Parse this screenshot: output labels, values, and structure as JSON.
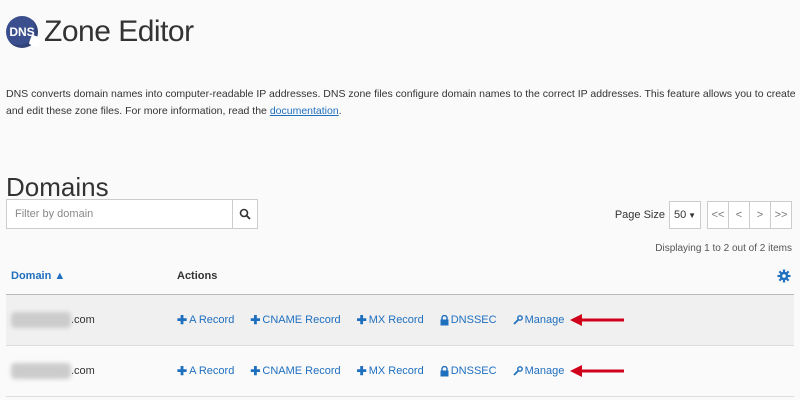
{
  "header": {
    "logo_text": "DNS",
    "title": "Zone Editor"
  },
  "description": {
    "text": "DNS converts domain names into computer-readable IP addresses. DNS zone files configure domain names to the correct IP addresses. This feature allows you to create and edit these zone files. For more information, read the ",
    "link": "documentation",
    "end": "."
  },
  "section_title": "Domains",
  "search": {
    "placeholder": "Filter by domain",
    "value": ""
  },
  "pager": {
    "label": "Page Size",
    "size": "50",
    "first": "<<",
    "prev": "<",
    "next": ">",
    "last": ">>"
  },
  "display_count": "Displaying 1 to 2 out of 2 items",
  "table": {
    "col_domain": "Domain ▲",
    "col_actions": "Actions",
    "rows": [
      {
        "domain_suffix": ".com",
        "actions": {
          "a": "A Record",
          "cname": "CNAME Record",
          "mx": "MX Record",
          "dnssec": "DNSSEC",
          "manage": "Manage"
        }
      },
      {
        "domain_suffix": ".com",
        "actions": {
          "a": "A Record",
          "cname": "CNAME Record",
          "mx": "MX Record",
          "dnssec": "DNSSEC",
          "manage": "Manage"
        }
      }
    ]
  },
  "colors": {
    "link": "#1f6fbf",
    "arrow": "#d0021b",
    "logo": "#3b4f8f"
  },
  "icons": {
    "search": "search-icon",
    "gear": "gear-icon",
    "plus": "plus-icon",
    "lock": "lock-icon",
    "wrench": "wrench-icon"
  }
}
